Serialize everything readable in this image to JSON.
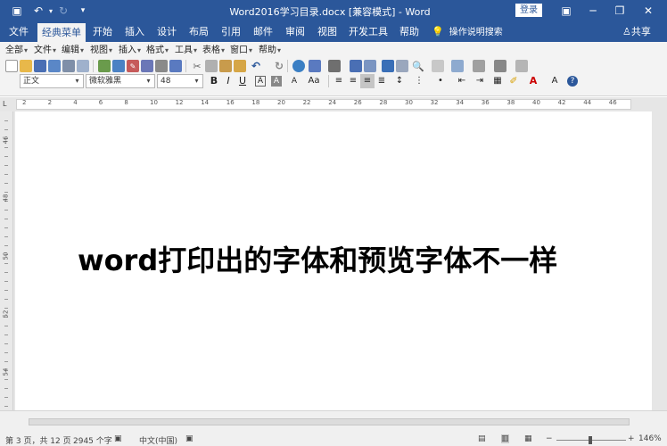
{
  "titlebar": {
    "title": "Word2016学习目录.docx [兼容模式] - Word",
    "login": "登录",
    "save_icon": "save-icon",
    "undo_icon": "undo-icon",
    "redo_icon": "redo-icon",
    "minimize": "─",
    "restore": "❐",
    "close": "✕",
    "ribbon_opts": "▣"
  },
  "tabs": [
    "文件",
    "经典菜单",
    "开始",
    "插入",
    "设计",
    "布局",
    "引用",
    "邮件",
    "审阅",
    "视图",
    "开发工具",
    "帮助"
  ],
  "tell_me": "操作说明搜索",
  "share": "共享",
  "classic_menu": [
    "全部",
    "文件",
    "编辑",
    "视图",
    "插入",
    "格式",
    "工具",
    "表格",
    "窗口",
    "帮助"
  ],
  "format": {
    "style": "正文",
    "font": "微软雅黑",
    "size": "48",
    "bold": "B",
    "italic": "I",
    "underline": "U",
    "font_color_letter": "A",
    "char_border_letter": "A",
    "case": "Aa"
  },
  "ruler_numbers": [
    "2",
    "2",
    "4",
    "6",
    "8",
    "10",
    "12",
    "14",
    "16",
    "18",
    "20",
    "22",
    "24",
    "26",
    "28",
    "30",
    "32",
    "34",
    "36",
    "38",
    "40",
    "42",
    "44",
    "46"
  ],
  "vruler_numbers": [
    "46",
    "48",
    "50",
    "52",
    "54",
    "56"
  ],
  "document": {
    "headline": "word打印出的字体和预览字体不一样"
  },
  "status": {
    "page": "第 3 页，共 12 页",
    "words": "2945 个字",
    "language": "中文(中国)",
    "zoom": "146%",
    "zoom_minus": "−",
    "zoom_plus": "+"
  }
}
